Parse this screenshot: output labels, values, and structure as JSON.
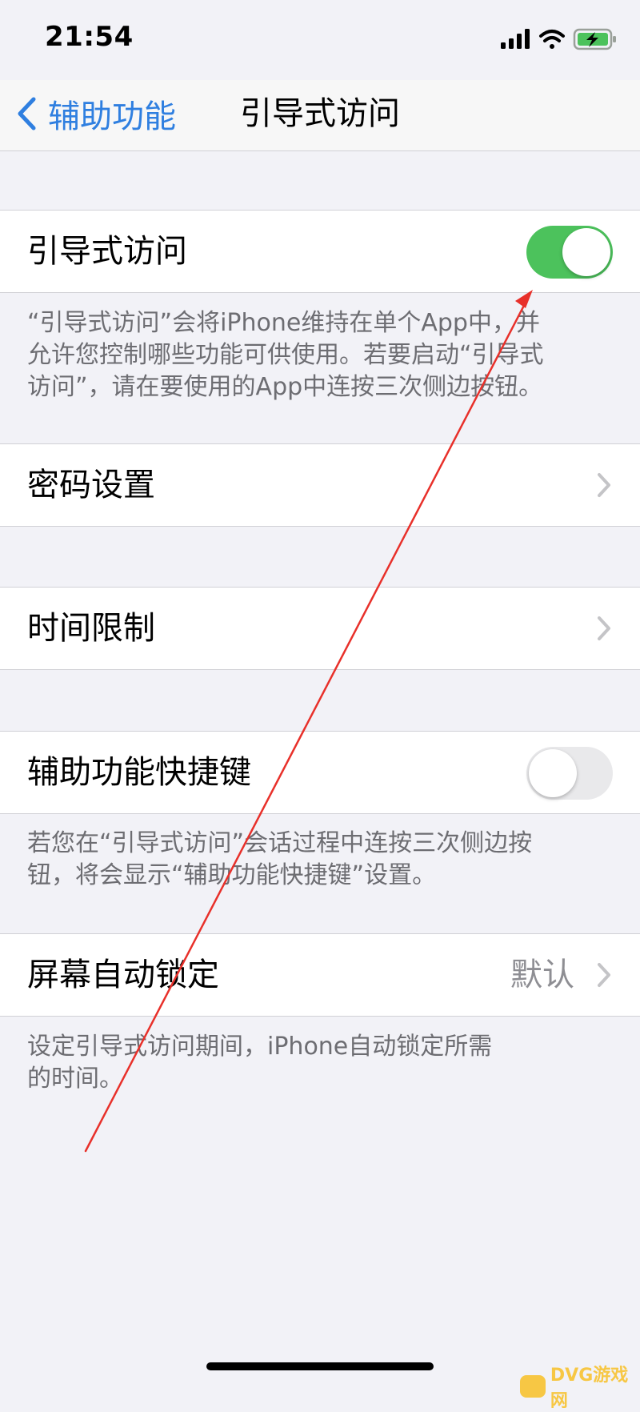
{
  "status_bar": {
    "time": "21:54"
  },
  "nav": {
    "back_label": "辅助功能",
    "title": "引导式访问"
  },
  "rows": {
    "guided_access": {
      "label": "引导式访问",
      "toggle_on": true
    },
    "passcode": {
      "label": "密码设置"
    },
    "time_limits": {
      "label": "时间限制"
    },
    "accessibility_shortcut": {
      "label": "辅助功能快捷键",
      "toggle_on": false
    },
    "auto_lock": {
      "label": "屏幕自动锁定",
      "value": "默认"
    }
  },
  "footers": {
    "guided_access_line1": "“引导式访问”会将iPhone维持在单个App中，并",
    "guided_access_line2": "允许您控制哪些功能可供使用。若要启动“引导式",
    "guided_access_line3": "访问”，请在要使用的App中连按三次侧边按钮。",
    "shortcut_line1": "若您在“引导式访问”会话过程中连按三次侧边按",
    "shortcut_line2": "钮，将会显示“辅助功能快捷键”设置。",
    "auto_lock_line1": "设定引导式访问期间，iPhone自动锁定所需",
    "auto_lock_line2": "的时间。"
  },
  "watermark": {
    "text": "DVG游戏网"
  },
  "colors": {
    "accent": "#2f7fe0",
    "toggle_on": "#4cc25c",
    "annotation": "#e8302a"
  },
  "icons": [
    "chevron-left-icon",
    "signal-icon",
    "wifi-icon",
    "battery-charging-icon",
    "chevron-right-icon"
  ]
}
